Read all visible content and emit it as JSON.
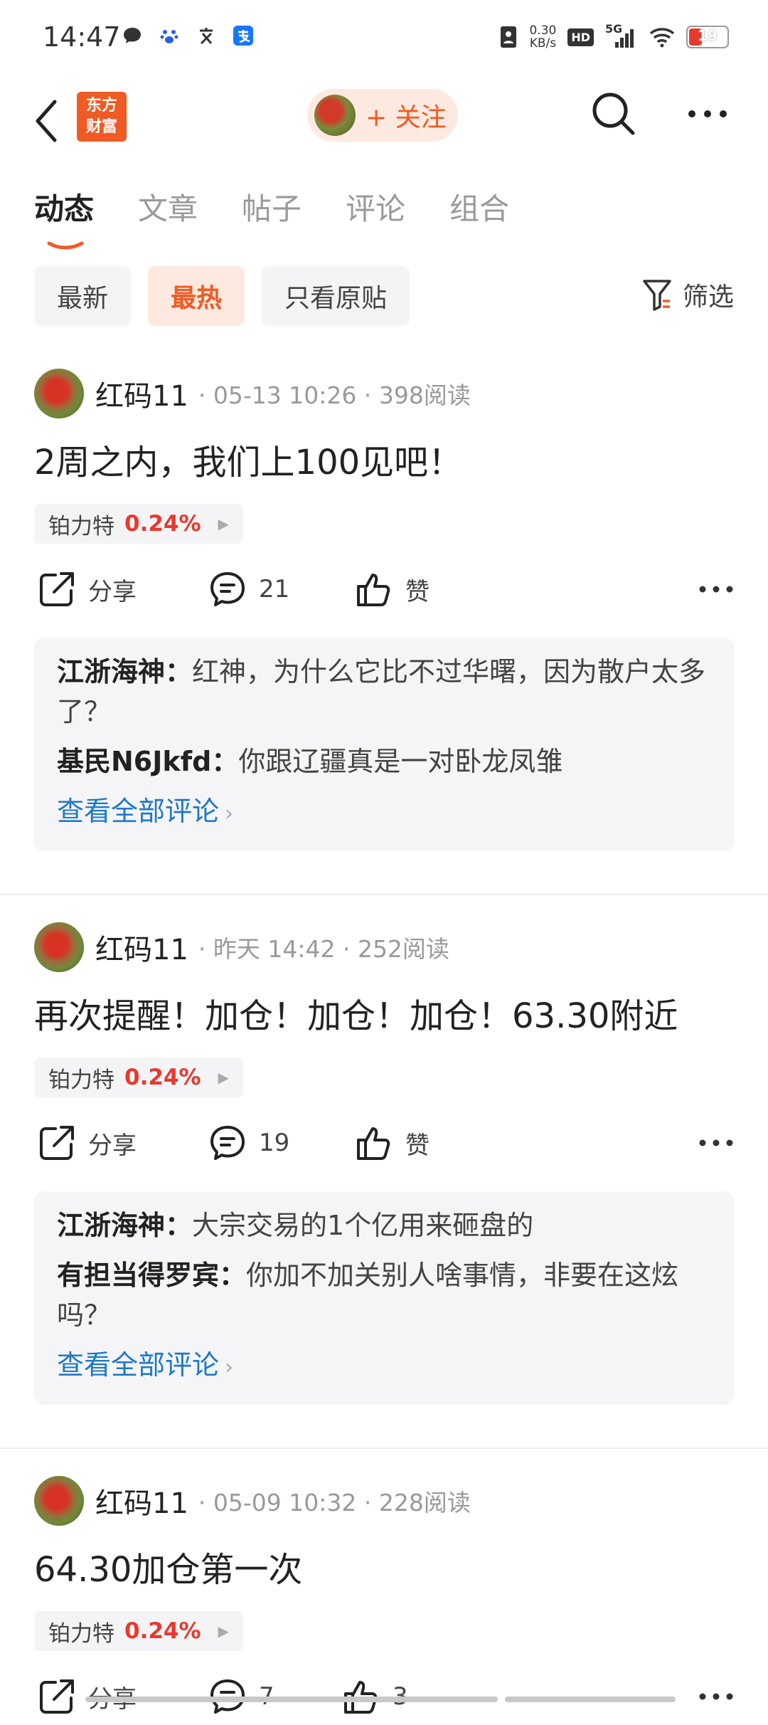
{
  "status_bar": {
    "time": "14:47",
    "speed_value": "0.30",
    "speed_unit": "KB/s",
    "hd": "HD",
    "network": "5G",
    "battery": "19"
  },
  "header": {
    "logo_text": "东方财富",
    "follow_label": "+ 关注"
  },
  "tabs": [
    {
      "label": "动态",
      "active": true
    },
    {
      "label": "文章",
      "active": false
    },
    {
      "label": "帖子",
      "active": false
    },
    {
      "label": "评论",
      "active": false
    },
    {
      "label": "组合",
      "active": false
    }
  ],
  "filters": {
    "chips": [
      {
        "label": "最新",
        "active": false
      },
      {
        "label": "最热",
        "active": true
      },
      {
        "label": "只看原贴",
        "active": false
      }
    ],
    "filter_label": "筛选"
  },
  "posts": [
    {
      "author": "红码11",
      "meta": "· 05-13 10:26 · 398阅读",
      "title": "2周之内，我们上100见吧！",
      "stock_name": "铂力特",
      "stock_pct": "0.24%",
      "share_label": "分享",
      "comment_count": "21",
      "like_label": "赞",
      "comments": [
        {
          "user": "江浙海神",
          "text": "红神，为什么它比不过华曙，因为散户太多了？"
        },
        {
          "user": "基民N6Jkfd",
          "text": "你跟辽疆真是一对卧龙凤雏"
        }
      ],
      "view_all": "查看全部评论"
    },
    {
      "author": "红码11",
      "meta": "· 昨天 14:42 · 252阅读",
      "title": "再次提醒！加仓！加仓！加仓！63.30附近",
      "stock_name": "铂力特",
      "stock_pct": "0.24%",
      "share_label": "分享",
      "comment_count": "19",
      "like_label": "赞",
      "comments": [
        {
          "user": "江浙海神",
          "text": "大宗交易的1个亿用来砸盘的"
        },
        {
          "user": "有担当得罗宾",
          "text": "你加不加关别人啥事情，非要在这炫吗？"
        }
      ],
      "view_all": "查看全部评论"
    },
    {
      "author": "红码11",
      "meta": "· 05-09 10:32 · 228阅读",
      "title": "64.30加仓第一次",
      "stock_name": "铂力特",
      "stock_pct": "0.24%",
      "share_label": "分享",
      "comment_count": "7",
      "like_label": "3"
    }
  ]
}
